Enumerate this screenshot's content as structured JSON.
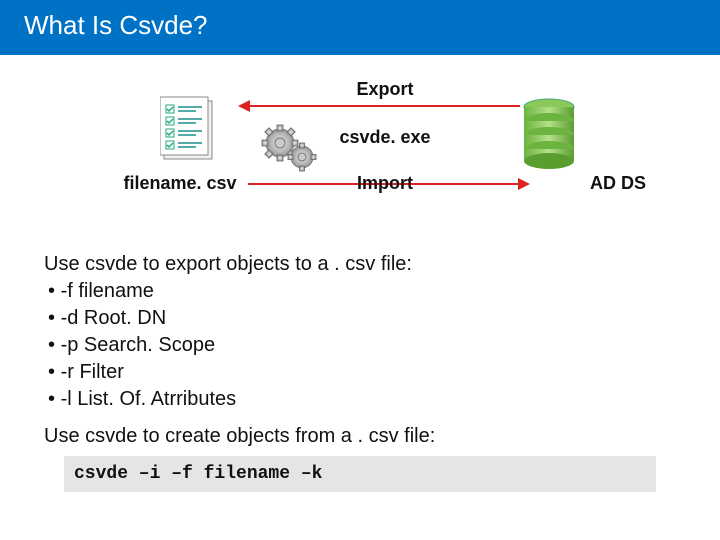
{
  "title": "What Is Csvde?",
  "diagram": {
    "export_label": "Export",
    "exe_label": "csvde. exe",
    "import_label": "Import",
    "file_label": "filename. csv",
    "db_label": "AD DS"
  },
  "body": {
    "export_intro": "Use csvde to export objects to a . csv file:",
    "bullets": [
      "-f filename",
      "-d Root. DN",
      "-p Search. Scope",
      "-r Filter",
      "-l List. Of. Atrributes"
    ],
    "create_intro": "Use csvde to create objects from a . csv file:",
    "code": "csvde –i –f filename –k"
  }
}
